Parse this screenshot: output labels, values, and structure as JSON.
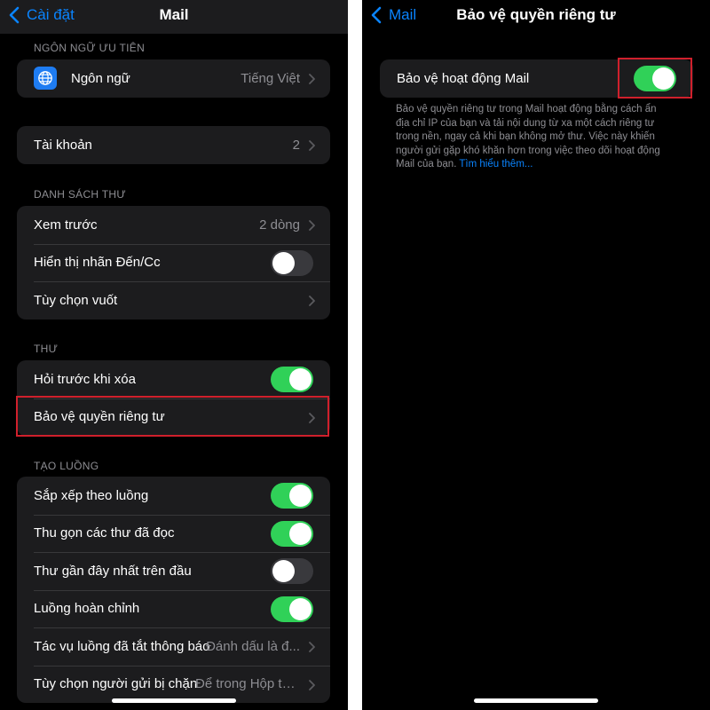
{
  "left": {
    "nav": {
      "back_label": "Cài đặt",
      "title": "Mail"
    },
    "sections": {
      "language": {
        "header": "NGÔN NGỮ ƯU TIÊN",
        "row": {
          "label": "Ngôn ngữ",
          "value": "Tiếng Việt",
          "icon": "globe-icon"
        }
      },
      "accounts": {
        "label": "Tài khoản",
        "value": "2"
      },
      "message_list": {
        "header": "DANH SÁCH THƯ",
        "rows": [
          {
            "label": "Xem trước",
            "value": "2 dòng"
          },
          {
            "label": "Hiển thị nhãn Đến/Cc",
            "toggle": false
          },
          {
            "label": "Tùy chọn vuốt"
          }
        ]
      },
      "messages": {
        "header": "THƯ",
        "rows": [
          {
            "label": "Hỏi trước khi xóa",
            "toggle": true
          },
          {
            "label": "Bảo vệ quyền riêng tư"
          }
        ]
      },
      "threading": {
        "header": "TẠO LUỒNG",
        "rows": [
          {
            "label": "Sắp xếp theo luồng",
            "toggle": true
          },
          {
            "label": "Thu gọn các thư đã đọc",
            "toggle": true
          },
          {
            "label": "Thư gần đây nhất trên đầu",
            "toggle": false
          },
          {
            "label": "Luồng hoàn chỉnh",
            "toggle": true
          },
          {
            "label": "Tác vụ luồng đã tắt thông báo",
            "value": "Đánh dấu là đ..."
          },
          {
            "label": "Tùy chọn người gửi bị chặn",
            "value": "Để trong Hộp th..."
          }
        ]
      }
    }
  },
  "right": {
    "nav": {
      "back_label": "Mail",
      "title": "Bảo vệ quyền riêng tư"
    },
    "row": {
      "label": "Bảo vệ hoạt động Mail",
      "toggle": true
    },
    "footer_lines": [
      "Bảo vệ quyền riêng tư trong Mail hoạt động bằng cách ẩn",
      "địa chỉ IP của bạn và tải nội dung từ xa một cách riêng tư",
      "trong nền, ngay cả khi bạn không mở thư. Việc này khiến",
      "người gửi gặp khó khăn hơn trong việc theo dõi hoạt động"
    ],
    "footer_last": "Mail của bạn.",
    "footer_link": "Tìm hiểu thêm..."
  },
  "colors": {
    "accent": "#0a84ff",
    "toggle_on": "#30d158",
    "toggle_off": "#39393d",
    "highlight": "#d0202c",
    "cell_background": "#1c1c1e"
  }
}
